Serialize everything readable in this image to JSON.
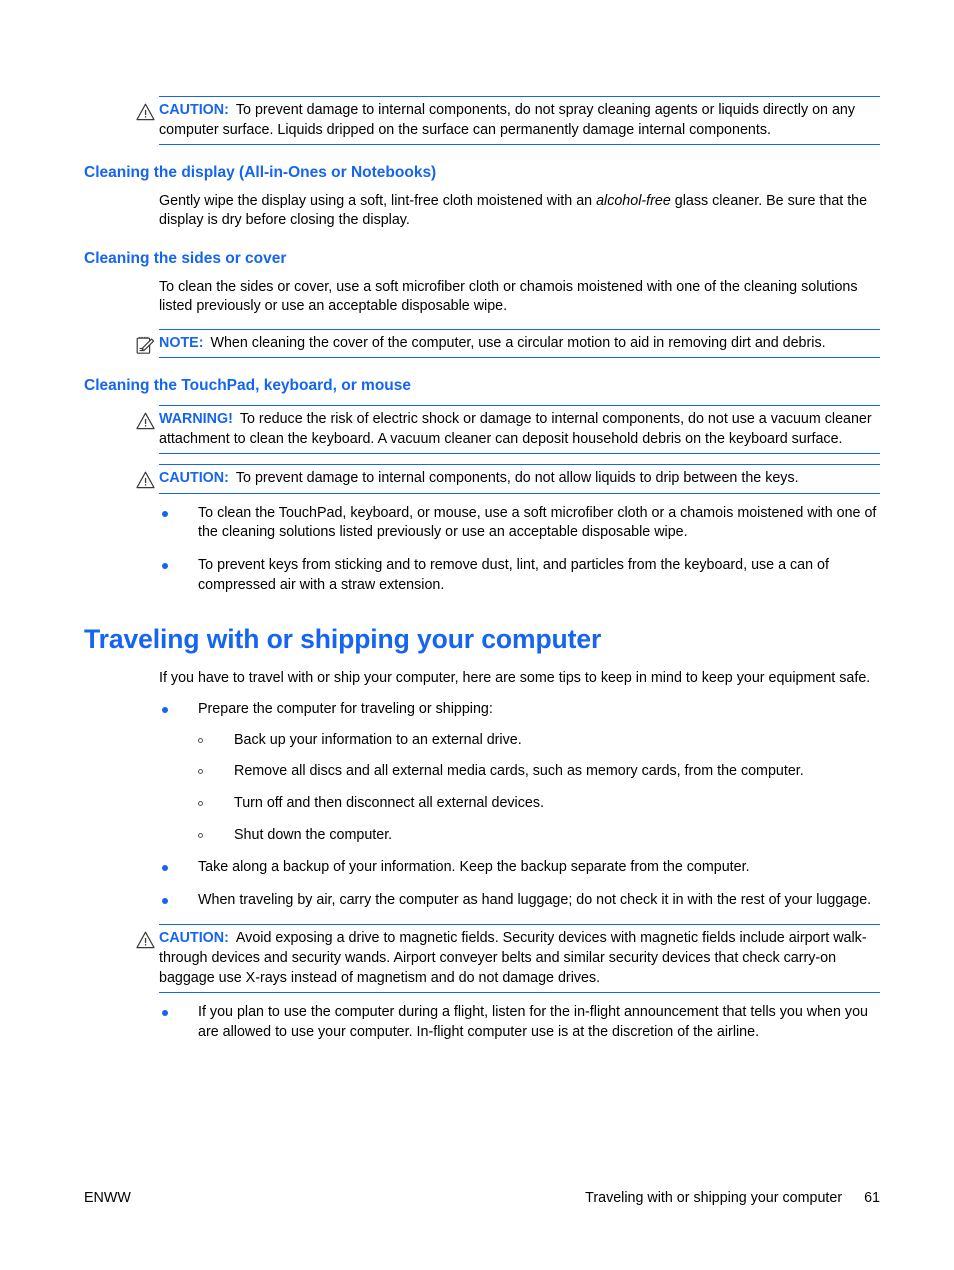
{
  "page": {
    "footer_left": "ENWW",
    "footer_section": "Traveling with or shipping your computer",
    "footer_page_number": "61"
  },
  "colors": {
    "heading_blue": "#1565f0",
    "label_blue": "#1565f0",
    "rule_blue": "#1565f0",
    "bullet_blue": "#1565f0",
    "body_black": "#000000"
  },
  "admonitions": {
    "caution_spray": {
      "icon": "warning-triangle-icon",
      "label": "CAUTION:",
      "text": "To prevent damage to internal components, do not spray cleaning agents or liquids directly on any computer surface. Liquids dripped on the surface can permanently damage internal components."
    },
    "note_circular_motion": {
      "icon": "note-clipboard-icon",
      "label": "NOTE:",
      "text": "When cleaning the cover of the computer, use a circular motion to aid in removing dirt and debris."
    },
    "warning_vacuum": {
      "icon": "warning-triangle-icon",
      "label": "WARNING!",
      "text": "To reduce the risk of electric shock or damage to internal components, do not use a vacuum cleaner attachment to clean the keyboard. A vacuum cleaner can deposit household debris on the keyboard surface."
    },
    "caution_keys": {
      "icon": "warning-triangle-icon",
      "label": "CAUTION:",
      "text": "To prevent damage to internal components, do not allow liquids to drip between the keys."
    },
    "caution_magnetic": {
      "icon": "warning-triangle-icon",
      "label": "CAUTION:",
      "text": "Avoid exposing a drive to magnetic fields. Security devices with magnetic fields include airport walk-through devices and security wands. Airport conveyer belts and similar security devices that check carry-on baggage use X-rays instead of magnetism and do not damage drives."
    }
  },
  "sections": {
    "cleaning_display": {
      "heading": "Cleaning the display (All-in-Ones or Notebooks)",
      "paragraph_before_italic": "Gently wipe the display using a soft, lint-free cloth moistened with an ",
      "paragraph_italic": "alcohol-free",
      "paragraph_after_italic": " glass cleaner. Be sure that the display is dry before closing the display."
    },
    "cleaning_sides": {
      "heading": "Cleaning the sides or cover",
      "paragraph": "To clean the sides or cover, use a soft microfiber cloth or chamois moistened with one of the cleaning solutions listed previously or use an acceptable disposable wipe."
    },
    "cleaning_touchpad": {
      "heading": "Cleaning the TouchPad, keyboard, or mouse",
      "bullets": [
        "To clean the TouchPad, keyboard, or mouse, use a soft microfiber cloth or a chamois moistened with one of the cleaning solutions listed previously or use an acceptable disposable wipe.",
        "To prevent keys from sticking and to remove dust, lint, and particles from the keyboard, use a can of compressed air with a straw extension."
      ]
    },
    "traveling": {
      "heading": "Traveling with or shipping your computer",
      "intro": "If you have to travel with or ship your computer, here are some tips to keep in mind to keep your equipment safe.",
      "bullet_prepare": "Prepare the computer for traveling or shipping:",
      "subbullets_prepare": [
        "Back up your information to an external drive.",
        "Remove all discs and all external media cards, such as memory cards, from the computer.",
        "Turn off and then disconnect all external devices.",
        "Shut down the computer."
      ],
      "bullet_backup": "Take along a backup of your information. Keep the backup separate from the computer.",
      "bullet_air": "When traveling by air, carry the computer as hand luggage; do not check it in with the rest of your luggage.",
      "bullet_flight": "If you plan to use the computer during a flight, listen for the in-flight announcement that tells you when you are allowed to use your computer. In-flight computer use is at the discretion of the airline."
    }
  }
}
